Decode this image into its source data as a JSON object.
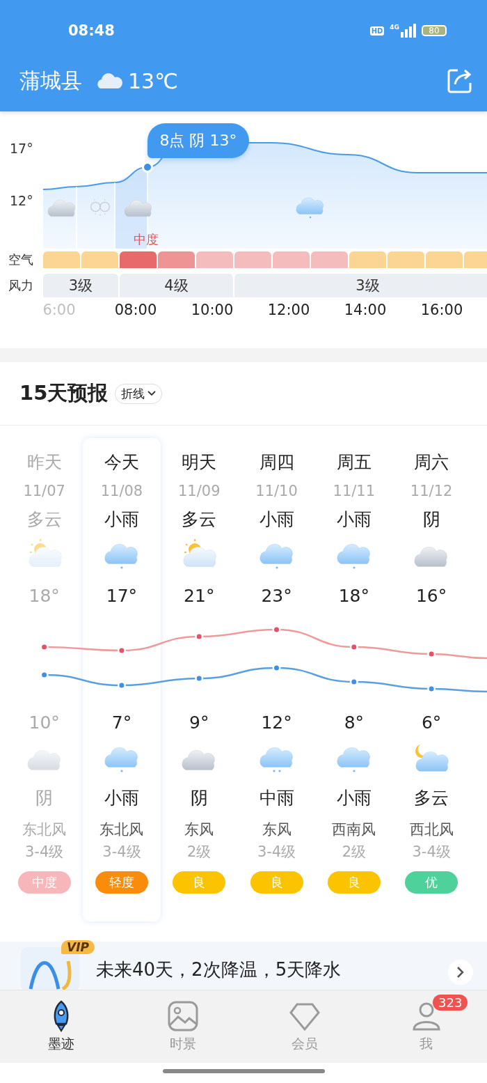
{
  "status_bar": {
    "time": "08:48",
    "hd": "HD",
    "network": "4G",
    "battery": "80"
  },
  "header": {
    "city": "蒲城县",
    "temperature": "13℃"
  },
  "hourly": {
    "y_labels": [
      "17°",
      "12°"
    ],
    "tooltip": "8点 阴 13°",
    "air_note": "中度",
    "air_label": "空气",
    "wind_label": "风力",
    "weather": [
      {
        "kind": "cloud"
      },
      {
        "kind": "fog"
      },
      {
        "kind": "cloud"
      },
      {
        "kind": "rain"
      }
    ],
    "air": [
      {
        "color": "#fad594"
      },
      {
        "color": "#fad594"
      },
      {
        "color": "#e86a6a"
      },
      {
        "color": "#ee9494"
      },
      {
        "color": "#f4bcbc"
      },
      {
        "color": "#f4bcbc"
      },
      {
        "color": "#f4bcbc"
      },
      {
        "color": "#f4bcbc"
      },
      {
        "color": "#fad594"
      },
      {
        "color": "#fad594"
      },
      {
        "color": "#fad594"
      },
      {
        "color": "#fad594"
      }
    ],
    "wind": [
      {
        "text": "3级"
      },
      {
        "text": "4级"
      },
      {
        "text": "3级"
      }
    ],
    "times": [
      "6:00",
      "08:00",
      "10:00",
      "12:00",
      "14:00",
      "16:00"
    ]
  },
  "forecast": {
    "title": "15天预报",
    "mode": "折线",
    "days": [
      {
        "day": "昨天",
        "date": "11/07",
        "weather": "多云",
        "day_icon": {
          "kind": "sun-cloud"
        },
        "high": "18°",
        "low": "10°",
        "night_icon": {
          "kind": "cloud"
        },
        "night_weather": "阴",
        "wind_dir": "东北风",
        "wind_level": "3-4级",
        "aqi": "中度",
        "color": "#f7b7ba",
        "past": true,
        "selected": false
      },
      {
        "day": "今天",
        "date": "11/08",
        "weather": "小雨",
        "day_icon": {
          "kind": "rain"
        },
        "high": "17°",
        "low": "7°",
        "night_icon": {
          "kind": "rain"
        },
        "night_weather": "小雨",
        "wind_dir": "东北风",
        "wind_level": "3-4级",
        "aqi": "轻度",
        "color": "#fa8c0c",
        "past": false,
        "selected": true
      },
      {
        "day": "明天",
        "date": "11/09",
        "weather": "多云",
        "day_icon": {
          "kind": "sun-cloud"
        },
        "high": "21°",
        "low": "9°",
        "night_icon": {
          "kind": "cloud"
        },
        "night_weather": "阴",
        "wind_dir": "东风",
        "wind_level": "2级",
        "aqi": "良",
        "color": "#fcc400",
        "past": false,
        "selected": false
      },
      {
        "day": "周四",
        "date": "11/10",
        "weather": "小雨",
        "day_icon": {
          "kind": "rain"
        },
        "high": "23°",
        "low": "12°",
        "night_icon": {
          "kind": "heavy-rain"
        },
        "night_weather": "中雨",
        "wind_dir": "东风",
        "wind_level": "3-4级",
        "aqi": "良",
        "color": "#fcc400",
        "past": false,
        "selected": false
      },
      {
        "day": "周五",
        "date": "11/11",
        "weather": "小雨",
        "day_icon": {
          "kind": "rain"
        },
        "high": "18°",
        "low": "8°",
        "night_icon": {
          "kind": "rain"
        },
        "night_weather": "小雨",
        "wind_dir": "西南风",
        "wind_level": "2级",
        "aqi": "良",
        "color": "#fcc400",
        "past": false,
        "selected": false
      },
      {
        "day": "周六",
        "date": "11/12",
        "weather": "阴",
        "day_icon": {
          "kind": "cloud"
        },
        "high": "16°",
        "low": "6°",
        "night_icon": {
          "kind": "moon-cloud"
        },
        "night_weather": "多云",
        "wind_dir": "西北风",
        "wind_level": "3-4级",
        "aqi": "优",
        "color": "#4fd19c",
        "past": false,
        "selected": false
      }
    ]
  },
  "banner": {
    "badge": "VIP",
    "text": "未来40天，2次降温，5天降水"
  },
  "nav": [
    {
      "label": "墨迹",
      "kind": "rocket",
      "selected": true
    },
    {
      "label": "时景",
      "kind": "photo",
      "selected": false
    },
    {
      "label": "会员",
      "kind": "diamond",
      "selected": false
    },
    {
      "label": "我",
      "kind": "person",
      "selected": false,
      "badge": "323"
    }
  ]
}
